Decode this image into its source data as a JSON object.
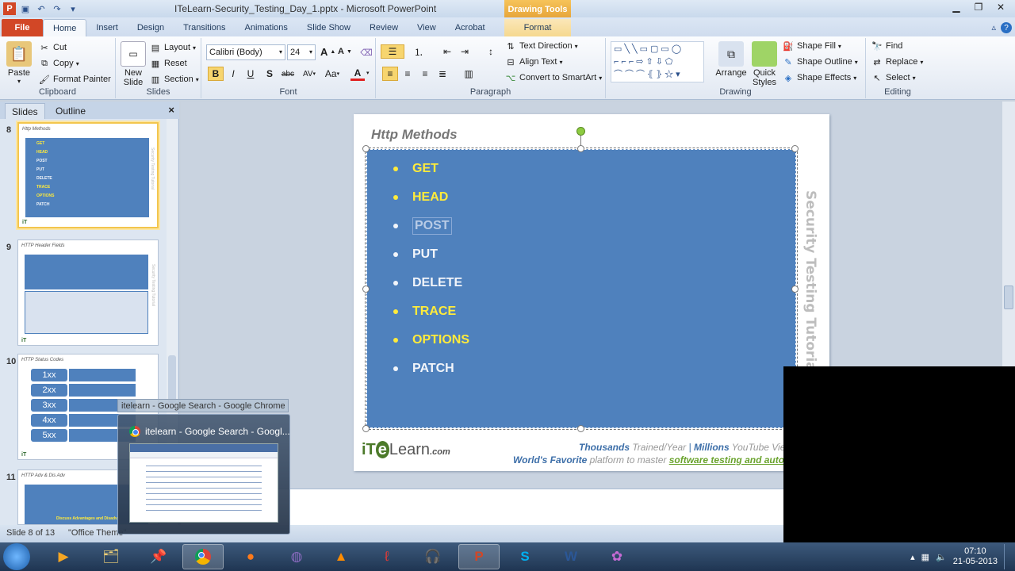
{
  "window": {
    "title": "ITeLearn-Security_Testing_Day_1.pptx - Microsoft PowerPoint",
    "contextual_group": "Drawing Tools",
    "contextual_tab": "Format"
  },
  "tabs": [
    "File",
    "Home",
    "Insert",
    "Design",
    "Transitions",
    "Animations",
    "Slide Show",
    "Review",
    "View",
    "Acrobat"
  ],
  "ribbon": {
    "clipboard": {
      "label": "Clipboard",
      "paste": "Paste",
      "cut": "Cut",
      "copy": "Copy",
      "format_painter": "Format Painter"
    },
    "slides": {
      "label": "Slides",
      "new_slide_1": "New",
      "new_slide_2": "Slide",
      "layout": "Layout",
      "reset": "Reset",
      "section": "Section"
    },
    "font": {
      "label": "Font",
      "family": "Calibri (Body)",
      "size": "24",
      "bold": "B",
      "italic": "I",
      "underline": "U",
      "strike": "S",
      "strike_abc": "abc",
      "spacing": "AV",
      "case": "Aa",
      "color_a": "A",
      "grow": "A",
      "shrink": "A"
    },
    "paragraph": {
      "label": "Paragraph",
      "text_direction": "Text Direction",
      "align_text": "Align Text",
      "convert_smartart": "Convert to SmartArt"
    },
    "drawing": {
      "label": "Drawing",
      "arrange": "Arrange",
      "quick_styles_1": "Quick",
      "quick_styles_2": "Styles",
      "shape_fill": "Shape Fill",
      "shape_outline": "Shape Outline",
      "shape_effects": "Shape Effects"
    },
    "editing": {
      "label": "Editing",
      "find": "Find",
      "replace": "Replace",
      "select": "Select"
    }
  },
  "pane": {
    "tab_slides": "Slides",
    "tab_outline": "Outline",
    "close": "×",
    "thumbnails": [
      {
        "num": "8",
        "title": "Http Methods",
        "items": [
          "GET",
          "HEAD",
          "POST",
          "PUT",
          "DELETE",
          "TRACE",
          "OPTIONS",
          "PATCH"
        ]
      },
      {
        "num": "9",
        "title": "HTTP Header Fields"
      },
      {
        "num": "10",
        "title": "HTTP Status Codes",
        "codes": [
          "1xx",
          "2xx",
          "3xx",
          "4xx",
          "5xx"
        ]
      },
      {
        "num": "11",
        "title": "HTTP Adv & Dis Adv",
        "caption": "Discuss Advantages and Disadv..."
      }
    ]
  },
  "slide": {
    "title": "Http Methods",
    "bullets": [
      {
        "text": "GET",
        "color": "yellow"
      },
      {
        "text": "HEAD",
        "color": "yellow"
      },
      {
        "text": "POST",
        "color": "white"
      },
      {
        "text": "PUT",
        "color": "white"
      },
      {
        "text": "DELETE",
        "color": "white"
      },
      {
        "text": "TRACE",
        "color": "yellow"
      },
      {
        "text": "OPTIONS",
        "color": "yellow"
      },
      {
        "text": "PATCH",
        "color": "white"
      }
    ],
    "side_text": "Security Testing Tutorial",
    "logo_i": "iT",
    "logo_e": "e",
    "logo_learn": "Learn",
    "logo_com": ".com",
    "tagline": {
      "thousands": "Thousands",
      "trained": "Trained/Year",
      "millions": "Millions",
      "youtube": "YouTube Views",
      "worlds_favorite": "World's Favorite",
      "platform": "platform to master",
      "software_testing": "software testing and automation"
    }
  },
  "status": {
    "slide_pos": "Slide 8 of 13",
    "theme": "\"Office Theme\""
  },
  "chrome_preview": {
    "tooltip": "itelearn - Google Search - Google Chrome",
    "title": "itelearn - Google Search - Googl..."
  },
  "tray": {
    "time": "07:10",
    "date": "21-05-2013"
  },
  "colors": {
    "accent_blue": "#4f81bd",
    "bullet_yellow": "#ffeb3b",
    "file_tab": "#d24726"
  }
}
